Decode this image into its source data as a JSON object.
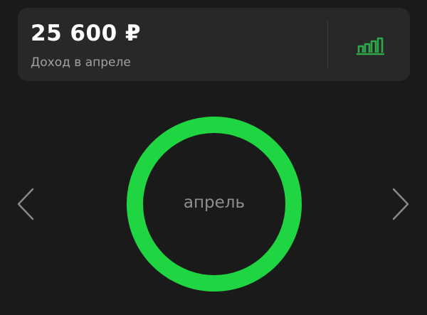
{
  "summary": {
    "amount": "25 600 ₽",
    "caption": "Доход в апреле"
  },
  "month": {
    "label": "апрель",
    "ring_fill_fraction": 1.0
  },
  "icons": {
    "stats": "bar-chart-icon",
    "prev": "chevron-left-icon",
    "next": "chevron-right-icon"
  },
  "colors": {
    "background": "#1a1a1a",
    "card": "#282828",
    "accent": "#1fd541",
    "chart_icon": "#2ea84a",
    "text_primary": "#ffffff",
    "text_secondary": "#a0a0a0",
    "month_label": "#8e8e8e",
    "arrow": "#8a8a8a"
  }
}
